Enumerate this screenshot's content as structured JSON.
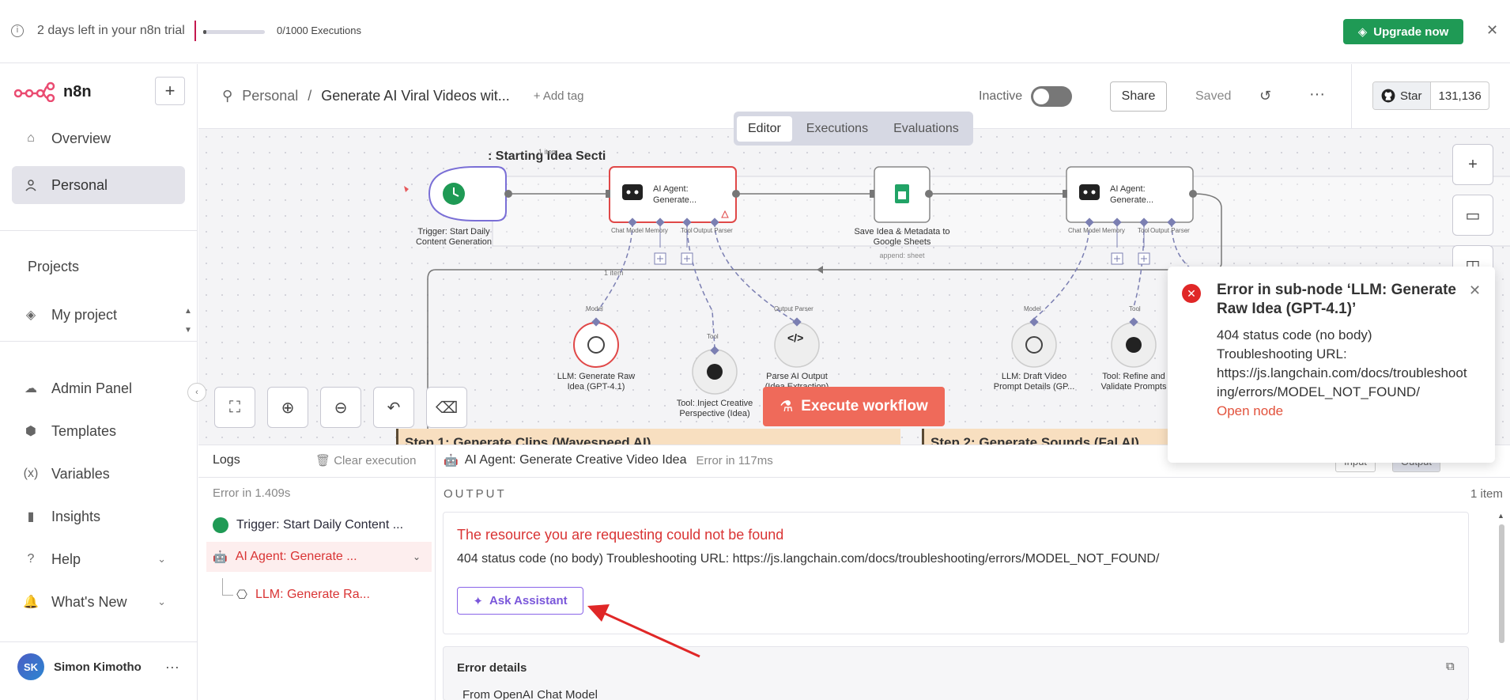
{
  "banner": {
    "trial_text": "2 days left in your n8n trial",
    "progress_fraction": 0.004,
    "executions_text": "0/1000 Executions",
    "upgrade_label": "Upgrade now"
  },
  "sidebar": {
    "brand": "n8n",
    "items": [
      {
        "label": "Overview"
      },
      {
        "label": "Personal"
      }
    ],
    "projects_title": "Projects",
    "project_item": "My project",
    "bottom_items": [
      {
        "label": "Admin Panel"
      },
      {
        "label": "Templates"
      },
      {
        "label": "Variables"
      },
      {
        "label": "Insights"
      },
      {
        "label": "Help"
      },
      {
        "label": "What's New"
      }
    ],
    "user": {
      "initials": "SK",
      "name": "Simon Kimotho"
    }
  },
  "header": {
    "breadcrumb_project": "Personal",
    "workflow_title": "Generate AI Viral Videos wit...",
    "add_tag": "+ Add tag",
    "status_label": "Inactive",
    "share_label": "Share",
    "saved_label": "Saved",
    "github": {
      "star_label": "Star",
      "count": "131,136"
    }
  },
  "editor_tabs": [
    {
      "label": "Editor"
    },
    {
      "label": "Executions"
    },
    {
      "label": "Evaluations"
    }
  ],
  "canvas": {
    "section_title": ": Starting Idea Secti",
    "one_item_top": "1 item",
    "one_item_mid": "1 item",
    "nodes": {
      "trigger": "Trigger: Start Daily Content Generation",
      "agent1_line1": "AI Agent:",
      "agent1_line2": "Generate...",
      "save_line1": "Save Idea & Metadata to",
      "save_line2": "Google Sheets",
      "save_sub": "append: sheet",
      "agent2_line1": "AI Agent:",
      "agent2_line2": "Generate...",
      "llm1_line1": "LLM: Generate Raw",
      "llm1_line2": "Idea (GPT-4.1)",
      "tool1_line1": "Tool: Inject Creative",
      "tool1_line2": "Perspective (Idea)",
      "parse_line1": "Parse AI Output",
      "parse_line2": "(Idea Extraction)",
      "llm2_line1": "LLM: Draft Video",
      "llm2_line2": "Prompt Details (GP...",
      "tool2_line1": "Tool: Refine and",
      "tool2_line2": "Validate Prompts"
    },
    "ports": {
      "chat_model": "Chat Model",
      "memory": "Memory",
      "tool": "Tool",
      "output_parser": "Output Parser",
      "model": "Model"
    },
    "execute_label": "Execute workflow",
    "sticky1": "Step 1: Generate Clips (Wavespeed AI)",
    "sticky2": "Step 2: Generate Sounds (Fal AI)"
  },
  "toast": {
    "title": "Error in sub-node ‘LLM: Generate Raw Idea (GPT-4.1)’",
    "line1": "404 status code (no body)",
    "line2": "Troubleshooting URL:",
    "url": "https://js.langchain.com/docs/troubleshooting/errors/MODEL_NOT_FOUND/",
    "open_node": "Open node"
  },
  "logs": {
    "title": "Logs",
    "clear_label": "Clear execution",
    "error_time": "Error in 1.409s",
    "rows": [
      {
        "label": "Trigger: Start Daily Content ..."
      },
      {
        "label": "AI Agent: Generate ..."
      },
      {
        "label": "LLM: Generate Ra..."
      }
    ]
  },
  "output": {
    "node_name": "AI Agent: Generate Creative Video Idea",
    "node_status": "Error in 117ms",
    "input_tab": "Input",
    "output_tab": "Output",
    "section_label": "OUTPUT",
    "items_count": "1 item",
    "error_message": "The resource you are requesting could not be found",
    "error_detail": "404 status code (no body) Troubleshooting URL: https://js.langchain.com/docs/troubleshooting/errors/MODEL_NOT_FOUND/",
    "ask_assistant": "Ask Assistant",
    "error_details_title": "Error details",
    "next_row": "From OpenAI Chat Model"
  },
  "colors": {
    "accent": "#1f9a55",
    "error": "#d93434",
    "execute": "#ef6a5a",
    "assistant": "#7a57da"
  }
}
